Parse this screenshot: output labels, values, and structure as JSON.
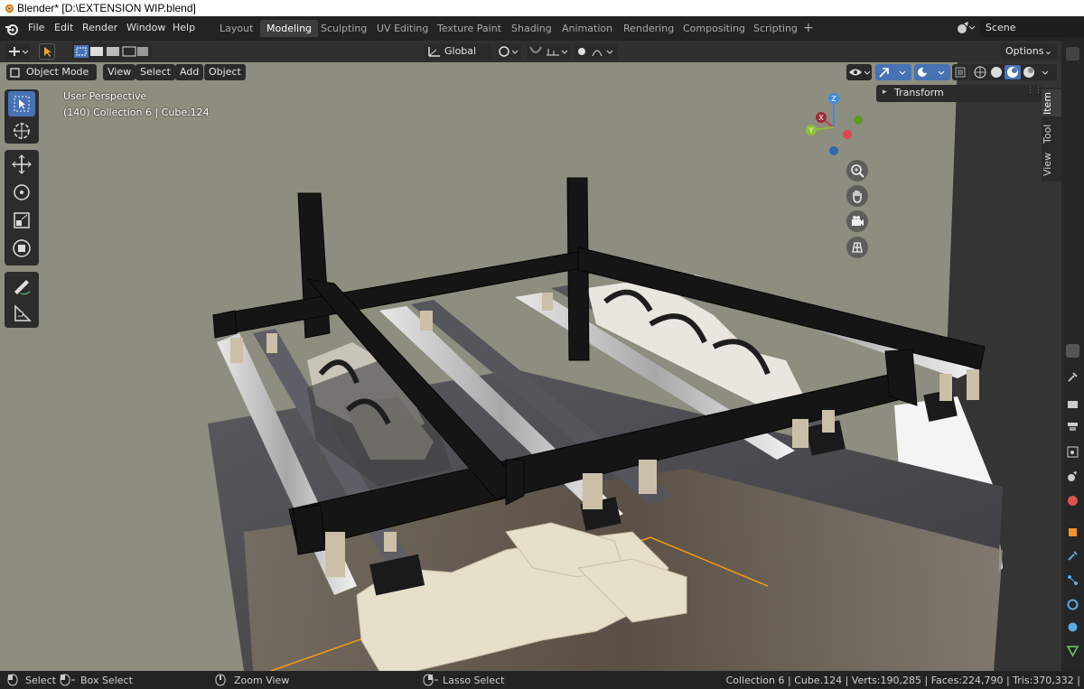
{
  "window": {
    "title": "Blender* [D:\\EXTENSION WIP.blend]"
  },
  "menu": [
    "File",
    "Edit",
    "Render",
    "Window",
    "Help"
  ],
  "workspaces": {
    "tabs": [
      {
        "label": "Layout"
      },
      {
        "label": "Modeling",
        "active": true
      },
      {
        "label": "Sculpting"
      },
      {
        "label": "UV Editing"
      },
      {
        "label": "Texture Paint"
      },
      {
        "label": "Shading"
      },
      {
        "label": "Animation"
      },
      {
        "label": "Rendering"
      },
      {
        "label": "Compositing"
      },
      {
        "label": "Scripting"
      }
    ],
    "add_label": "+"
  },
  "scene": {
    "label": "Scene"
  },
  "tool_header": {
    "orientation": "Global",
    "options": "Options"
  },
  "view_header": {
    "mode": "Object Mode",
    "menus": [
      "View",
      "Select",
      "Add",
      "Object"
    ]
  },
  "viewport": {
    "perspective": "User Perspective",
    "collection_info": "(140) Collection 6 | Cube.124",
    "gizmo": {
      "z": "Z",
      "x": "X",
      "y": "Y"
    }
  },
  "sidebar": {
    "tabs": [
      "Item",
      "Tool",
      "View"
    ],
    "panel_title": "Transform"
  },
  "status": {
    "select": "Select",
    "box_select": "Box Select",
    "zoom_view": "Zoom View",
    "lasso_select": "Lasso Select",
    "stats": "Collection 6 | Cube.124 | Verts:190,285 | Faces:224,790 | Tris:370,332 |"
  },
  "colors": {
    "accent": "#4772b3",
    "active_tab": "#3d3d3d",
    "viewport_bg": "#8d8d80",
    "selection_orange": "#f39c12"
  }
}
